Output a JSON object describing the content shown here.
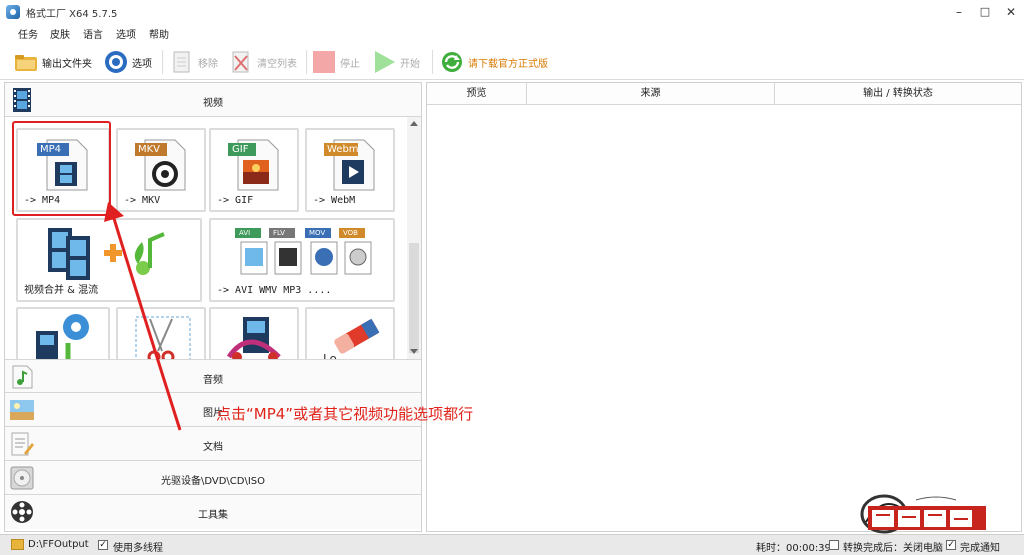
{
  "window": {
    "title": "格式工厂 X64 5.7.5",
    "minimize": "–",
    "maximize": "□",
    "close": "✕"
  },
  "menu": [
    "任务",
    "皮肤",
    "语言",
    "选项",
    "帮助"
  ],
  "toolbar": {
    "output_folder": "输出文件夹",
    "options": "选项",
    "remove": "移除",
    "clear_list": "清空列表",
    "stop": "停止",
    "start": "开始",
    "download": "请下载官方正式版"
  },
  "categories": {
    "video": "视频",
    "audio": "音频",
    "image": "图片",
    "document": "文档",
    "rom": "光驱设备\\DVD\\CD\\ISO",
    "tools": "工具集"
  },
  "tiles": [
    {
      "badge": "MP4",
      "badge_color": "#3a6fb5",
      "label": "-> MP4"
    },
    {
      "badge": "MKV",
      "badge_color": "#c07a2e",
      "label": "-> MKV"
    },
    {
      "badge": "GIF",
      "badge_color": "#3e9a5a",
      "label": "-> GIF"
    },
    {
      "badge": "Webm",
      "badge_color": "#d08a2a",
      "label": "-> WebM"
    },
    {
      "label": "视频合并 & 混流"
    },
    {
      "badges": [
        "AVI",
        "FLV",
        "MOV",
        "VOB"
      ],
      "label": "-> AVI WMV MP3 ...."
    }
  ],
  "table": {
    "columns": [
      "预览",
      "来源",
      "输出 / 转换状态"
    ]
  },
  "status": {
    "output_path": "D:\\FFOutput",
    "multithread": "使用多线程",
    "elapsed": "耗时：00:00:39",
    "after_convert": "转换完成后：关闭电脑",
    "notify": "完成通知"
  },
  "annotation": "点击“MP4”或者其它视频功能选项都行",
  "colors": {
    "annotation_red": "#e0241b",
    "download_orange": "#d87a00",
    "highlight_red": "#e02020"
  }
}
